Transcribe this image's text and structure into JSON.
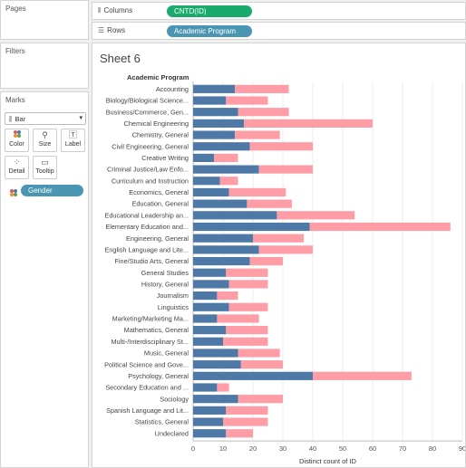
{
  "panels": {
    "pages_title": "Pages",
    "filters_title": "Filters",
    "marks_title": "Marks"
  },
  "marks": {
    "mark_type": "Bar",
    "buttons": {
      "color": "Color",
      "size": "Size",
      "label": "Label",
      "detail": "Detail",
      "tooltip": "Tooltip"
    },
    "color_field": "Gender"
  },
  "shelves": {
    "columns_label": "Columns",
    "columns_pill": "CNTD(ID)",
    "rows_label": "Rows",
    "rows_pill": "Academic Program"
  },
  "sheet": {
    "title": "Sheet 6"
  },
  "colors": {
    "series_blue": "#4e79a7",
    "series_pink": "#ff9da7",
    "pill_green": "#1aaa6e",
    "pill_teal": "#4a96b2"
  },
  "chart_data": {
    "type": "bar",
    "orientation": "horizontal",
    "stacked": true,
    "row_header": "Academic Program",
    "xlabel": "Distinct count of ID",
    "xlim": [
      0,
      90
    ],
    "xticks": [
      0,
      10,
      20,
      30,
      40,
      50,
      60,
      70,
      80,
      90
    ],
    "categories": [
      "Accounting",
      "Biology/Biological Science...",
      "Business/Commerce, Gen...",
      "Chemical Engineering",
      "Chemistry, General",
      "Civil Engineering, General",
      "Creative Writing",
      "Criminal Justice/Law Enfo...",
      "Curriculum and Instruction",
      "Economics, General",
      "Education, General",
      "Educational Leadership an...",
      "Elementary Education and...",
      "Engineering, General",
      "English Language and Lite...",
      "Fine/Studio Arts, General",
      "General Studies",
      "History, General",
      "Journalism",
      "Linguistics",
      "Marketing/Marketing Ma...",
      "Mathematics, General",
      "Multi-/Interdisciplinary St...",
      "Music, General",
      "Political Science and Gove...",
      "Psychology, General",
      "Secondary Education and ...",
      "Sociology",
      "Spanish Language and Lit...",
      "Statistics, General",
      "Undeclared"
    ],
    "series": [
      {
        "values": [
          14,
          11,
          15,
          17,
          14,
          19,
          7,
          22,
          9,
          12,
          18,
          28,
          39,
          20,
          22,
          19,
          11,
          12,
          8,
          12,
          8,
          11,
          10,
          15,
          16,
          40,
          8,
          15,
          11,
          10,
          11
        ]
      },
      {
        "values": [
          18,
          14,
          17,
          43,
          15,
          21,
          8,
          18,
          6,
          19,
          15,
          26,
          47,
          17,
          18,
          11,
          14,
          13,
          7,
          13,
          14,
          14,
          15,
          14,
          14,
          33,
          4,
          15,
          14,
          15,
          9
        ]
      }
    ]
  }
}
